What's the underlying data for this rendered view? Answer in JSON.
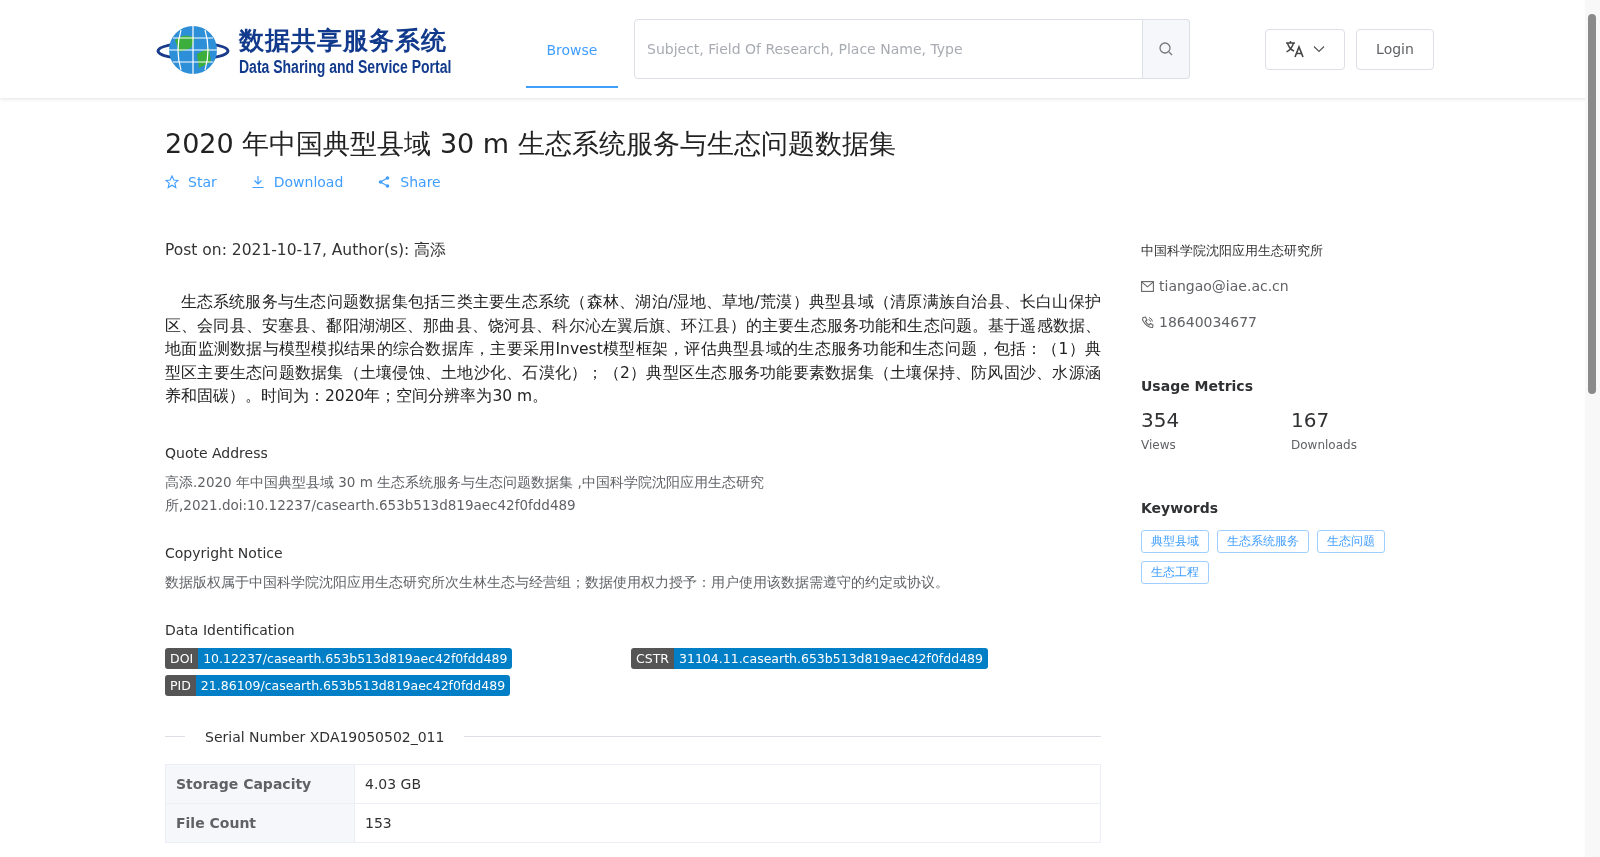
{
  "header": {
    "logo": {
      "title_cn": "数据共享服务系统",
      "title_en": "Data Sharing and Service Portal"
    },
    "nav": [
      {
        "label": "Browse",
        "selected": true
      }
    ],
    "search": {
      "placeholder": "Subject, Field Of Research, Place Name, Type"
    },
    "login": "Login"
  },
  "dataset": {
    "title": "2020 年中国典型县域 30 m 生态系统服务与生态问题数据集",
    "actions": [
      {
        "kind": "star",
        "label": "Star"
      },
      {
        "kind": "download",
        "label": "Download"
      },
      {
        "kind": "share",
        "label": "Share"
      }
    ],
    "post_info": "Post on: 2021-10-17, Author(s): 高添",
    "description": "生态系统服务与生态问题数据集包括三类主要生态系统（森林、湖泊/湿地、草地/荒漠）典型县域（清原满族自治县、长白山保护区、会同县、安塞县、鄱阳湖湖区、那曲县、饶河县、科尔沁左翼后旗、环江县）的主要生态服务功能和生态问题。基于遥感数据、地面监测数据与模型模拟结果的综合数据库，主要采用Invest模型框架，评估典型县域的生态服务功能和生态问题，包括：（1）典型区主要生态问题数据集（土壤侵蚀、土地沙化、石漠化）；（2）典型区生态服务功能要素数据集（土壤保持、防风固沙、水源涵养和固碳）。时间为：2020年；空间分辨率为30 m。",
    "sections": [
      {
        "heading": "Quote Address",
        "text": "高添.2020 年中国典型县域 30 m 生态系统服务与生态问题数据集 ,中国科学院沈阳应用生态研究所,2021.doi:10.12237/casearth.653b513d819aec42f0fdd489"
      },
      {
        "heading": "Copyright Notice",
        "text": "数据版权属于中国科学院沈阳应用生态研究所次生林生态与经营组；数据使用权力授予：用户使用该数据需遵守的约定或协议。"
      }
    ],
    "identification": {
      "heading": "Data Identification",
      "ids": [
        {
          "key": "DOI",
          "value": "10.12237/casearth.653b513d819aec42f0fdd489"
        },
        {
          "key": "CSTR",
          "value": "31104.11.casearth.653b513d819aec42f0fdd489"
        },
        {
          "key": "PID",
          "value": "21.86109/casearth.653b513d819aec42f0fdd489"
        }
      ]
    },
    "serial": "Serial Number XDA19050502_011",
    "table": {
      "rows": [
        {
          "label": "Storage Capacity",
          "value": "4.03 GB"
        },
        {
          "label": "File Count",
          "value": "153"
        }
      ]
    }
  },
  "sidebar": {
    "organization": "中国科学院沈阳应用生态研究所",
    "email": "tiangao@iae.ac.cn",
    "phone": "18640034677",
    "metrics": {
      "heading": "Usage Metrics",
      "items": [
        {
          "value": "354",
          "label": "Views"
        },
        {
          "value": "167",
          "label": "Downloads"
        }
      ]
    },
    "keywords": {
      "heading": "Keywords",
      "items": [
        "典型县域",
        "生态系统服务",
        "生态问题",
        "生态工程"
      ]
    }
  }
}
